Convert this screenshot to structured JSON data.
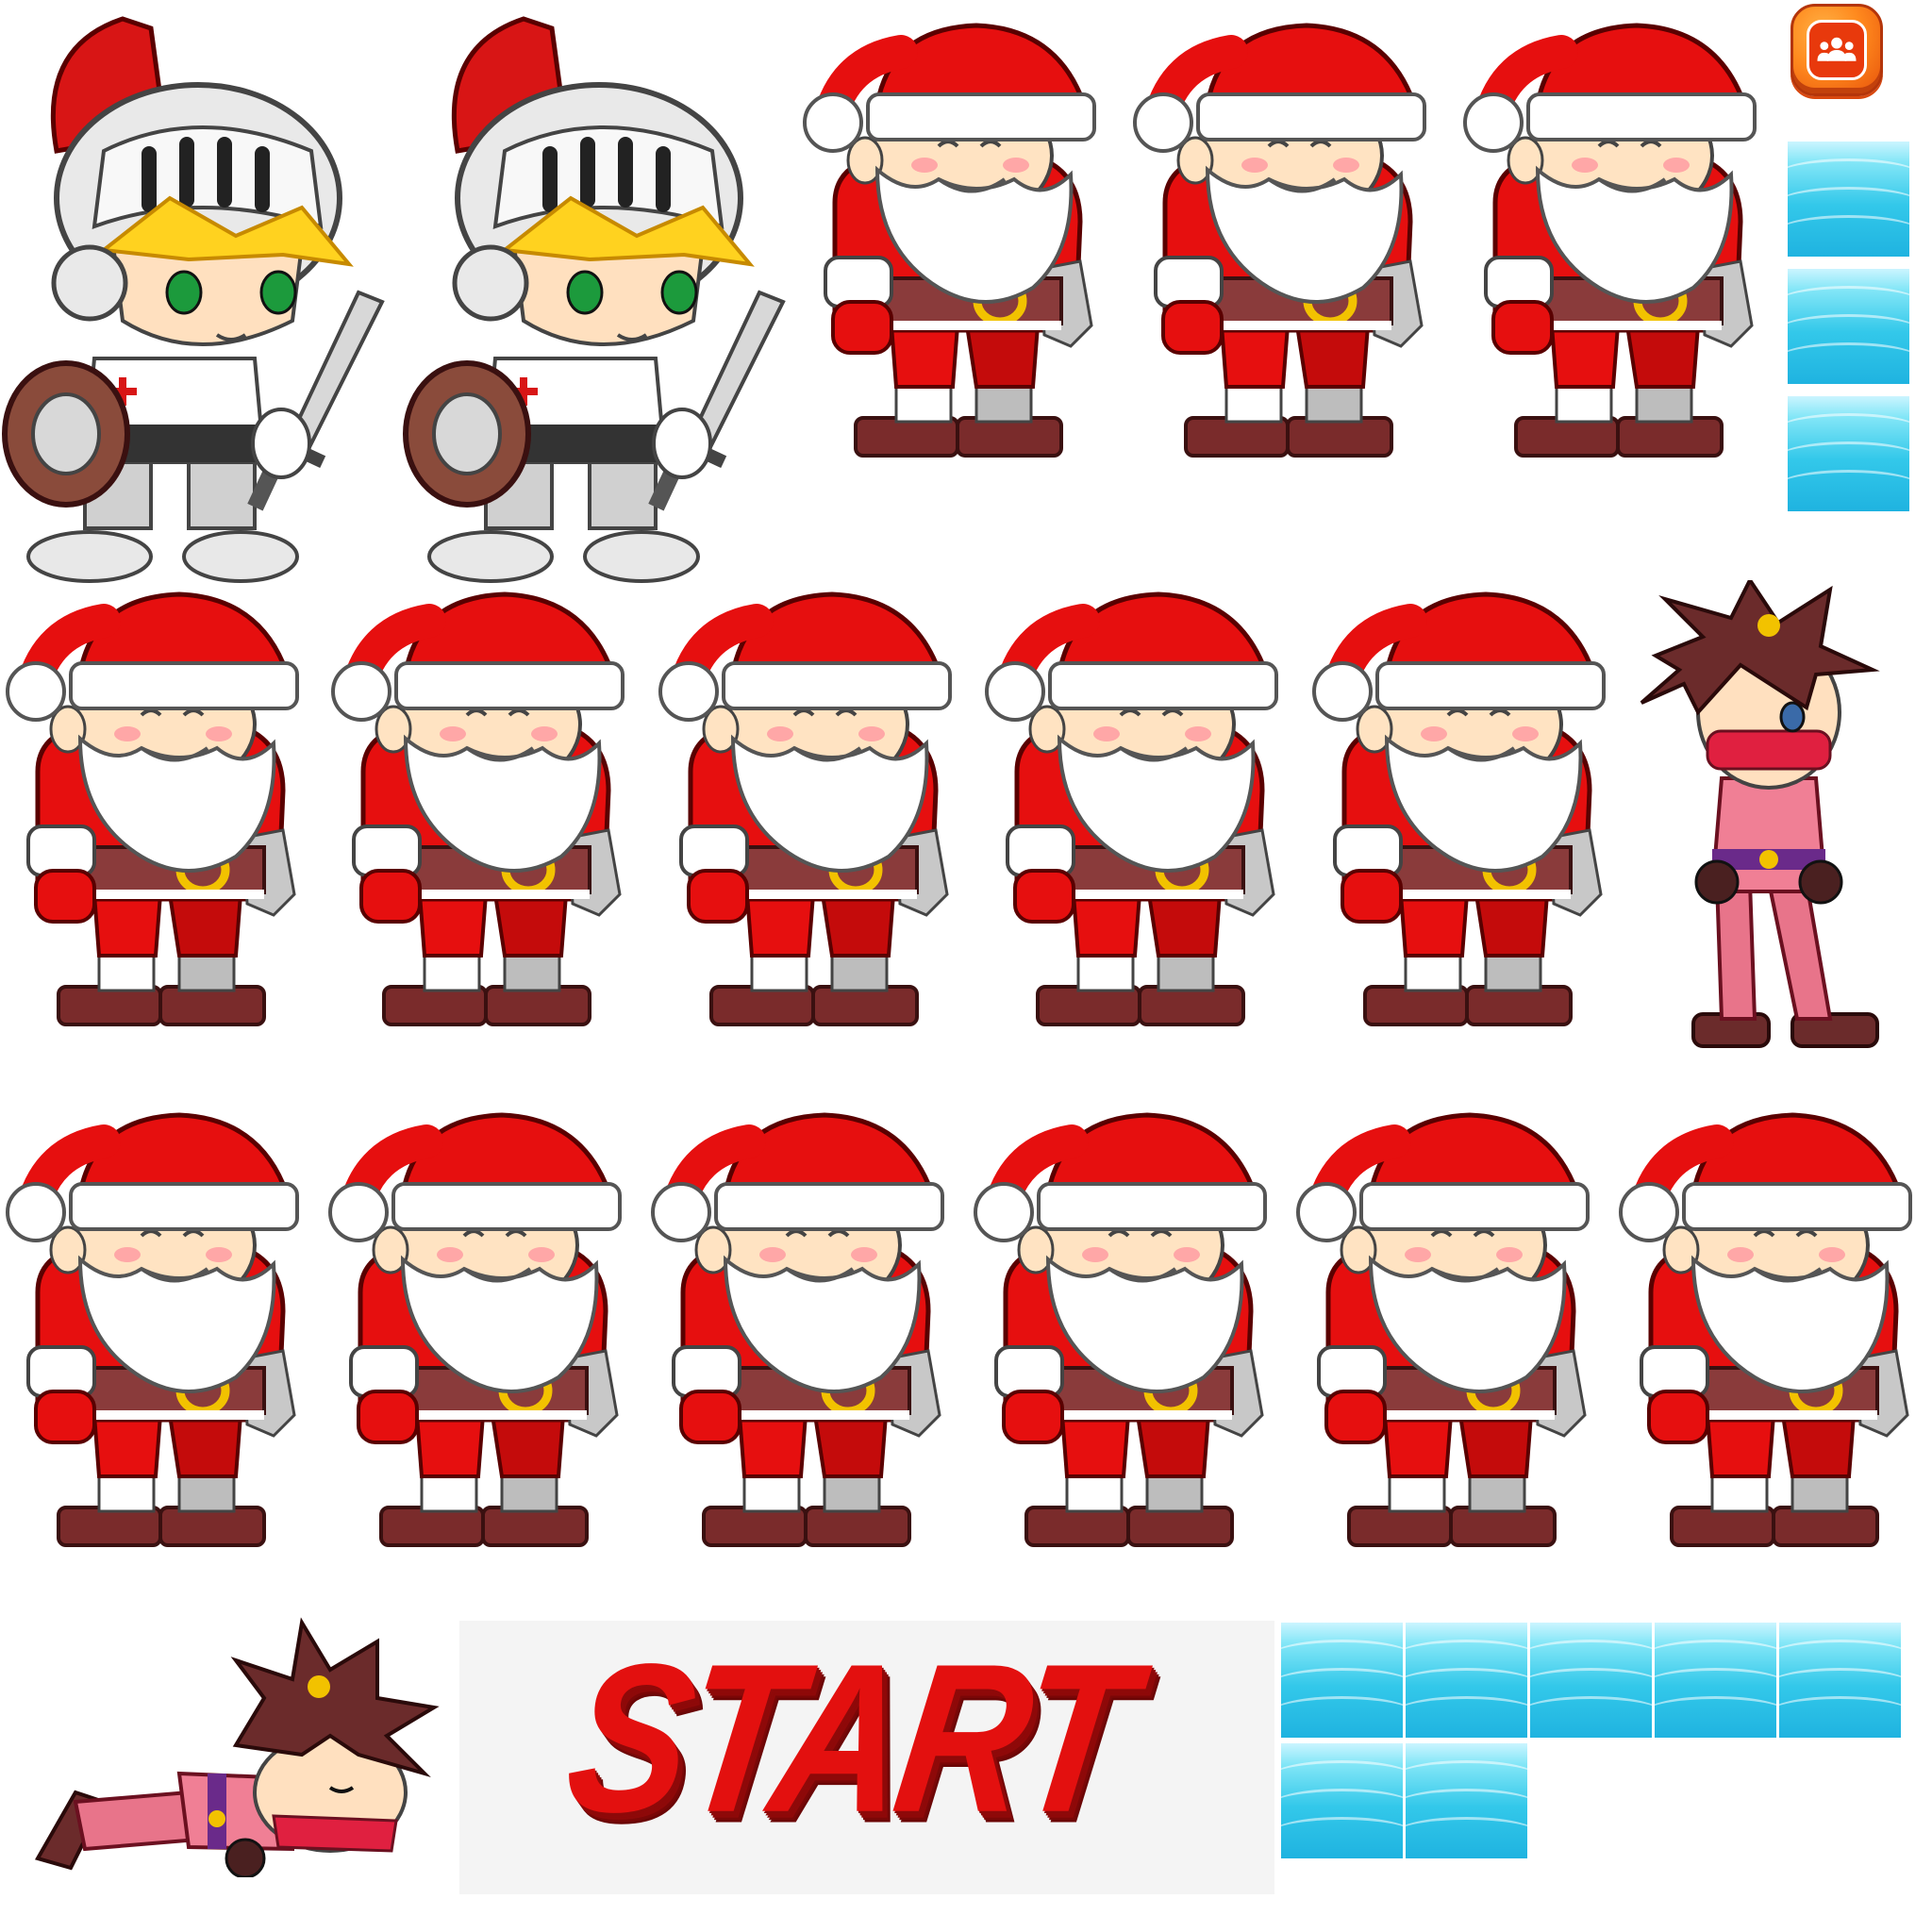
{
  "sheet": {
    "start_button": {
      "label": "START",
      "color": "#e3100f",
      "shadow_color": "#8e0909"
    },
    "icons": {
      "social_button": "group-icon"
    },
    "sprites": {
      "knight_count": 2,
      "santa_count": 14,
      "ninja_poses": [
        "standing",
        "lying"
      ],
      "water_tile_count": 10
    },
    "colors": {
      "background": "#ffffff",
      "santa_red": "#e60f0f",
      "santa_white": "#ffffff",
      "belt_brown": "#8a3b3b",
      "buckle_gold": "#f2c200",
      "water_light": "#83e6f7",
      "water_dark": "#1fb3e0",
      "button_orange": "#ff8a1e"
    }
  }
}
